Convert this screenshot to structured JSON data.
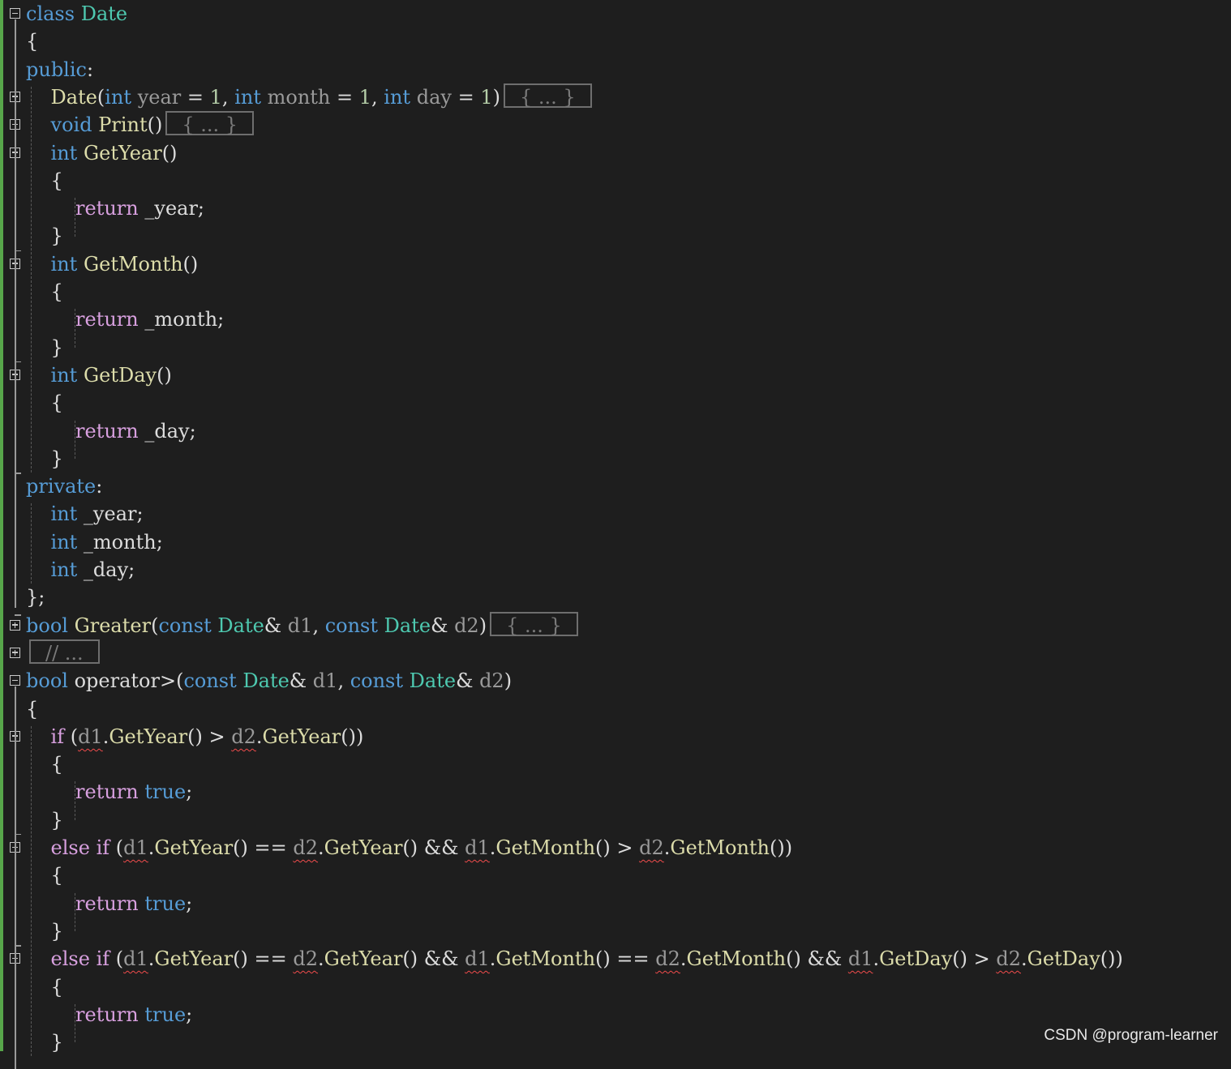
{
  "colors": {
    "background": "#1e1e1e",
    "keyword": "#569cd6",
    "control": "#d8a0df",
    "type": "#4ec9b0",
    "function": "#dcdcaa",
    "number": "#b5cea8",
    "parameter": "#9a9a9a",
    "text": "#dcdcdc",
    "change_bar": "#57a64a",
    "error_squiggle": "#f14c4c"
  },
  "editor": {
    "lines": [
      {
        "fold": "minus",
        "tokens": [
          {
            "t": "class",
            "c": "kw"
          },
          {
            "t": " "
          },
          {
            "t": "Date",
            "c": "type"
          }
        ]
      },
      {
        "tokens": [
          {
            "t": "{"
          }
        ]
      },
      {
        "tokens": [
          {
            "t": "public",
            "c": "kw"
          },
          {
            "t": ":"
          }
        ]
      },
      {
        "fold": "plus",
        "tokens": [
          {
            "t": "    "
          },
          {
            "t": "Date",
            "c": "fn"
          },
          {
            "t": "("
          },
          {
            "t": "int",
            "c": "kw"
          },
          {
            "t": " "
          },
          {
            "t": "year",
            "c": "param"
          },
          {
            "t": " = "
          },
          {
            "t": "1",
            "c": "num"
          },
          {
            "t": ", "
          },
          {
            "t": "int",
            "c": "kw"
          },
          {
            "t": " "
          },
          {
            "t": "month",
            "c": "param"
          },
          {
            "t": " = "
          },
          {
            "t": "1",
            "c": "num"
          },
          {
            "t": ", "
          },
          {
            "t": "int",
            "c": "kw"
          },
          {
            "t": " "
          },
          {
            "t": "day",
            "c": "param"
          },
          {
            "t": " = "
          },
          {
            "t": "1",
            "c": "num"
          },
          {
            "t": ")"
          },
          {
            "t": "{ ... }",
            "c": "fold"
          }
        ]
      },
      {
        "fold": "plus",
        "tokens": [
          {
            "t": "    "
          },
          {
            "t": "void",
            "c": "kw"
          },
          {
            "t": " "
          },
          {
            "t": "Print",
            "c": "fn"
          },
          {
            "t": "()"
          },
          {
            "t": "{ ... }",
            "c": "fold"
          }
        ]
      },
      {
        "fold": "minus",
        "tokens": [
          {
            "t": "    "
          },
          {
            "t": "int",
            "c": "kw"
          },
          {
            "t": " "
          },
          {
            "t": "GetYear",
            "c": "fn"
          },
          {
            "t": "()"
          }
        ]
      },
      {
        "tokens": [
          {
            "t": "    {"
          }
        ]
      },
      {
        "tokens": [
          {
            "t": "        "
          },
          {
            "t": "return",
            "c": "ctrl"
          },
          {
            "t": " _year;"
          }
        ]
      },
      {
        "tokens": [
          {
            "t": "    }"
          }
        ]
      },
      {
        "fold": "minus",
        "tokens": [
          {
            "t": "    "
          },
          {
            "t": "int",
            "c": "kw"
          },
          {
            "t": " "
          },
          {
            "t": "GetMonth",
            "c": "fn"
          },
          {
            "t": "()"
          }
        ]
      },
      {
        "tokens": [
          {
            "t": "    {"
          }
        ]
      },
      {
        "tokens": [
          {
            "t": "        "
          },
          {
            "t": "return",
            "c": "ctrl"
          },
          {
            "t": " _month;"
          }
        ]
      },
      {
        "tokens": [
          {
            "t": "    }"
          }
        ]
      },
      {
        "fold": "minus",
        "tokens": [
          {
            "t": "    "
          },
          {
            "t": "int",
            "c": "kw"
          },
          {
            "t": " "
          },
          {
            "t": "GetDay",
            "c": "fn"
          },
          {
            "t": "()"
          }
        ]
      },
      {
        "tokens": [
          {
            "t": "    {"
          }
        ]
      },
      {
        "tokens": [
          {
            "t": "        "
          },
          {
            "t": "return",
            "c": "ctrl"
          },
          {
            "t": " _day;"
          }
        ]
      },
      {
        "tokens": [
          {
            "t": "    }"
          }
        ]
      },
      {
        "tokens": [
          {
            "t": "private",
            "c": "kw"
          },
          {
            "t": ":"
          }
        ]
      },
      {
        "tokens": [
          {
            "t": "    "
          },
          {
            "t": "int",
            "c": "kw"
          },
          {
            "t": " _year;"
          }
        ]
      },
      {
        "tokens": [
          {
            "t": "    "
          },
          {
            "t": "int",
            "c": "kw"
          },
          {
            "t": " _month;"
          }
        ]
      },
      {
        "tokens": [
          {
            "t": "    "
          },
          {
            "t": "int",
            "c": "kw"
          },
          {
            "t": " _day;"
          }
        ]
      },
      {
        "tokens": [
          {
            "t": "};"
          }
        ]
      },
      {
        "fold": "plus",
        "tokens": [
          {
            "t": "bool",
            "c": "kw"
          },
          {
            "t": " "
          },
          {
            "t": "Greater",
            "c": "fn"
          },
          {
            "t": "("
          },
          {
            "t": "const",
            "c": "kw"
          },
          {
            "t": " "
          },
          {
            "t": "Date",
            "c": "type"
          },
          {
            "t": "& "
          },
          {
            "t": "d1",
            "c": "param"
          },
          {
            "t": ", "
          },
          {
            "t": "const",
            "c": "kw"
          },
          {
            "t": " "
          },
          {
            "t": "Date",
            "c": "type"
          },
          {
            "t": "& "
          },
          {
            "t": "d2",
            "c": "param"
          },
          {
            "t": ")"
          },
          {
            "t": "{ ... }",
            "c": "fold"
          }
        ]
      },
      {
        "fold": "plus",
        "tokens": [
          {
            "t": "// ...",
            "c": "fold"
          }
        ]
      },
      {
        "fold": "minus",
        "tokens": [
          {
            "t": "bool",
            "c": "kw"
          },
          {
            "t": " "
          },
          {
            "t": "operator>",
            "c": "txt"
          },
          {
            "t": "("
          },
          {
            "t": "const",
            "c": "kw"
          },
          {
            "t": " "
          },
          {
            "t": "Date",
            "c": "type"
          },
          {
            "t": "& "
          },
          {
            "t": "d1",
            "c": "param"
          },
          {
            "t": ", "
          },
          {
            "t": "const",
            "c": "kw"
          },
          {
            "t": " "
          },
          {
            "t": "Date",
            "c": "type"
          },
          {
            "t": "& "
          },
          {
            "t": "d2",
            "c": "param"
          },
          {
            "t": ")"
          }
        ]
      },
      {
        "tokens": [
          {
            "t": "{"
          }
        ]
      },
      {
        "fold": "minus",
        "tokens": [
          {
            "t": "    "
          },
          {
            "t": "if",
            "c": "ctrl"
          },
          {
            "t": " ("
          },
          {
            "t": "d1",
            "c": "param",
            "sq": true
          },
          {
            "t": "."
          },
          {
            "t": "GetYear",
            "c": "fn"
          },
          {
            "t": "() > "
          },
          {
            "t": "d2",
            "c": "param",
            "sq": true
          },
          {
            "t": "."
          },
          {
            "t": "GetYear",
            "c": "fn"
          },
          {
            "t": "())"
          }
        ]
      },
      {
        "tokens": [
          {
            "t": "    {"
          }
        ]
      },
      {
        "tokens": [
          {
            "t": "        "
          },
          {
            "t": "return",
            "c": "ctrl"
          },
          {
            "t": " "
          },
          {
            "t": "true",
            "c": "kw"
          },
          {
            "t": ";"
          }
        ]
      },
      {
        "tokens": [
          {
            "t": "    }"
          }
        ]
      },
      {
        "fold": "minus",
        "tokens": [
          {
            "t": "    "
          },
          {
            "t": "else",
            "c": "ctrl"
          },
          {
            "t": " "
          },
          {
            "t": "if",
            "c": "ctrl"
          },
          {
            "t": " ("
          },
          {
            "t": "d1",
            "c": "param",
            "sq": true
          },
          {
            "t": "."
          },
          {
            "t": "GetYear",
            "c": "fn"
          },
          {
            "t": "() == "
          },
          {
            "t": "d2",
            "c": "param",
            "sq": true
          },
          {
            "t": "."
          },
          {
            "t": "GetYear",
            "c": "fn"
          },
          {
            "t": "() && "
          },
          {
            "t": "d1",
            "c": "param",
            "sq": true
          },
          {
            "t": "."
          },
          {
            "t": "GetMonth",
            "c": "fn"
          },
          {
            "t": "() > "
          },
          {
            "t": "d2",
            "c": "param",
            "sq": true
          },
          {
            "t": "."
          },
          {
            "t": "GetMonth",
            "c": "fn"
          },
          {
            "t": "())"
          }
        ]
      },
      {
        "tokens": [
          {
            "t": "    {"
          }
        ]
      },
      {
        "tokens": [
          {
            "t": "        "
          },
          {
            "t": "return",
            "c": "ctrl"
          },
          {
            "t": " "
          },
          {
            "t": "true",
            "c": "kw"
          },
          {
            "t": ";"
          }
        ]
      },
      {
        "tokens": [
          {
            "t": "    }"
          }
        ]
      },
      {
        "fold": "minus",
        "tokens": [
          {
            "t": "    "
          },
          {
            "t": "else",
            "c": "ctrl"
          },
          {
            "t": " "
          },
          {
            "t": "if",
            "c": "ctrl"
          },
          {
            "t": " ("
          },
          {
            "t": "d1",
            "c": "param",
            "sq": true
          },
          {
            "t": "."
          },
          {
            "t": "GetYear",
            "c": "fn"
          },
          {
            "t": "() == "
          },
          {
            "t": "d2",
            "c": "param",
            "sq": true
          },
          {
            "t": "."
          },
          {
            "t": "GetYear",
            "c": "fn"
          },
          {
            "t": "() && "
          },
          {
            "t": "d1",
            "c": "param",
            "sq": true
          },
          {
            "t": "."
          },
          {
            "t": "GetMonth",
            "c": "fn"
          },
          {
            "t": "() == "
          },
          {
            "t": "d2",
            "c": "param",
            "sq": true
          },
          {
            "t": "."
          },
          {
            "t": "GetMonth",
            "c": "fn"
          },
          {
            "t": "() && "
          },
          {
            "t": "d1",
            "c": "param",
            "sq": true
          },
          {
            "t": "."
          },
          {
            "t": "GetDay",
            "c": "fn"
          },
          {
            "t": "() > "
          },
          {
            "t": "d2",
            "c": "param",
            "sq": true
          },
          {
            "t": "."
          },
          {
            "t": "GetDay",
            "c": "fn"
          },
          {
            "t": "())"
          }
        ]
      },
      {
        "tokens": [
          {
            "t": "    {"
          }
        ]
      },
      {
        "tokens": [
          {
            "t": "        "
          },
          {
            "t": "return",
            "c": "ctrl"
          },
          {
            "t": " "
          },
          {
            "t": "true",
            "c": "kw"
          },
          {
            "t": ";"
          }
        ]
      },
      {
        "tokens": [
          {
            "t": "    }"
          }
        ]
      }
    ]
  },
  "watermark": "CSDN @program-learner"
}
